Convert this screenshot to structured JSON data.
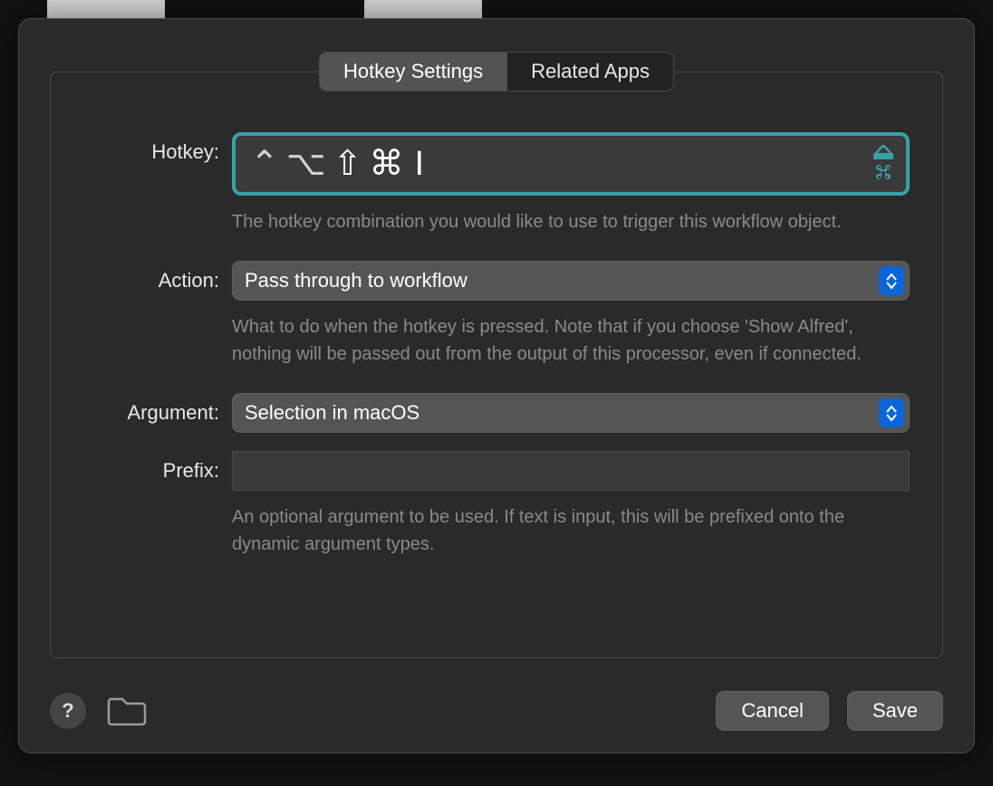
{
  "tabs": {
    "hotkey": "Hotkey Settings",
    "related": "Related Apps"
  },
  "form": {
    "hotkey": {
      "label": "Hotkey:",
      "modifiers": {
        "ctrl": "⌃",
        "opt": "⌥",
        "shift": "⇧",
        "cmd": "⌘"
      },
      "key": "I",
      "clear_icon_color": "#3aa0a6",
      "help": "The hotkey combination you would like to use to trigger this workflow object."
    },
    "action": {
      "label": "Action:",
      "value": "Pass through to workflow",
      "help": "What to do when the hotkey is pressed. Note that if you choose 'Show Alfred', nothing will be passed out from the output of this processor, even if connected."
    },
    "argument": {
      "label": "Argument:",
      "value": "Selection in macOS"
    },
    "prefix": {
      "label": "Prefix:",
      "value": "",
      "help": "An optional argument to be used. If text is input, this will be prefixed onto the dynamic argument types."
    }
  },
  "footer": {
    "help_glyph": "?",
    "cancel": "Cancel",
    "save": "Save"
  }
}
